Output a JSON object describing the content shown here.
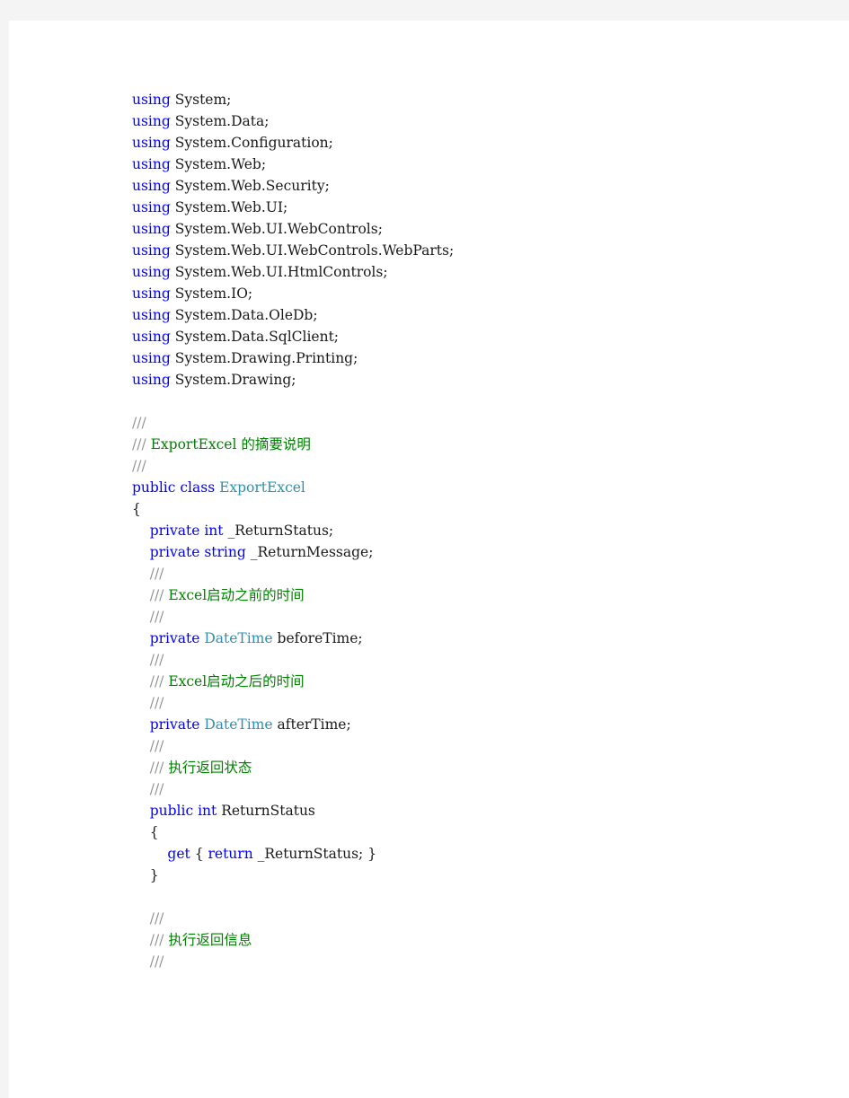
{
  "document": {
    "language": "csharp",
    "colors": {
      "page_background": "#ffffff",
      "outer_background": "#f4f4f4",
      "keyword": "#0000ff",
      "type": "#2b91af",
      "comment": "#008000",
      "comment_slash": "#909090",
      "plain": "#1a1a1a"
    },
    "lines": [
      {
        "indent": 0,
        "tokens": [
          {
            "t": "using ",
            "c": "kw"
          },
          {
            "t": "System;",
            "c": "pln"
          }
        ]
      },
      {
        "indent": 0,
        "tokens": [
          {
            "t": "using ",
            "c": "kw"
          },
          {
            "t": "System.Data;",
            "c": "pln"
          }
        ]
      },
      {
        "indent": 0,
        "tokens": [
          {
            "t": "using ",
            "c": "kw"
          },
          {
            "t": "System.Configuration;",
            "c": "pln"
          }
        ]
      },
      {
        "indent": 0,
        "tokens": [
          {
            "t": "using ",
            "c": "kw"
          },
          {
            "t": "System.Web;",
            "c": "pln"
          }
        ]
      },
      {
        "indent": 0,
        "tokens": [
          {
            "t": "using ",
            "c": "kw"
          },
          {
            "t": "System.Web.Security;",
            "c": "pln"
          }
        ]
      },
      {
        "indent": 0,
        "tokens": [
          {
            "t": "using ",
            "c": "kw"
          },
          {
            "t": "System.Web.UI;",
            "c": "pln"
          }
        ]
      },
      {
        "indent": 0,
        "tokens": [
          {
            "t": "using ",
            "c": "kw"
          },
          {
            "t": "System.Web.UI.WebControls;",
            "c": "pln"
          }
        ]
      },
      {
        "indent": 0,
        "tokens": [
          {
            "t": "using ",
            "c": "kw"
          },
          {
            "t": "System.Web.UI.WebControls.WebParts;",
            "c": "pln"
          }
        ]
      },
      {
        "indent": 0,
        "tokens": [
          {
            "t": "using ",
            "c": "kw"
          },
          {
            "t": "System.Web.UI.HtmlControls;",
            "c": "pln"
          }
        ]
      },
      {
        "indent": 0,
        "tokens": [
          {
            "t": "using ",
            "c": "kw"
          },
          {
            "t": "System.IO;",
            "c": "pln"
          }
        ]
      },
      {
        "indent": 0,
        "tokens": [
          {
            "t": "using ",
            "c": "kw"
          },
          {
            "t": "System.Data.OleDb;",
            "c": "pln"
          }
        ]
      },
      {
        "indent": 0,
        "tokens": [
          {
            "t": "using ",
            "c": "kw"
          },
          {
            "t": "System.Data.SqlClient;",
            "c": "pln"
          }
        ]
      },
      {
        "indent": 0,
        "tokens": [
          {
            "t": "using ",
            "c": "kw"
          },
          {
            "t": "System.Drawing.Printing;",
            "c": "pln"
          }
        ]
      },
      {
        "indent": 0,
        "tokens": [
          {
            "t": "using ",
            "c": "kw"
          },
          {
            "t": "System.Drawing;",
            "c": "pln"
          }
        ]
      },
      {
        "indent": 0,
        "tokens": []
      },
      {
        "indent": 0,
        "tokens": [
          {
            "t": "///",
            "c": "cmt-slash"
          }
        ]
      },
      {
        "indent": 0,
        "tokens": [
          {
            "t": "/// ",
            "c": "cmt-slash"
          },
          {
            "t": "ExportExcel 的摘要说明",
            "c": "cmt"
          }
        ]
      },
      {
        "indent": 0,
        "tokens": [
          {
            "t": "///",
            "c": "cmt-slash"
          }
        ]
      },
      {
        "indent": 0,
        "tokens": [
          {
            "t": "public ",
            "c": "kw"
          },
          {
            "t": "class ",
            "c": "kw"
          },
          {
            "t": "ExportExcel",
            "c": "type"
          }
        ]
      },
      {
        "indent": 0,
        "tokens": [
          {
            "t": "{",
            "c": "pln"
          }
        ]
      },
      {
        "indent": 1,
        "tokens": [
          {
            "t": "private ",
            "c": "kw"
          },
          {
            "t": "int ",
            "c": "kw"
          },
          {
            "t": "_ReturnStatus;",
            "c": "pln"
          }
        ]
      },
      {
        "indent": 1,
        "tokens": [
          {
            "t": "private ",
            "c": "kw"
          },
          {
            "t": "string ",
            "c": "kw"
          },
          {
            "t": "_ReturnMessage;",
            "c": "pln"
          }
        ]
      },
      {
        "indent": 1,
        "tokens": [
          {
            "t": "///",
            "c": "cmt-slash"
          }
        ]
      },
      {
        "indent": 1,
        "tokens": [
          {
            "t": "/// ",
            "c": "cmt-slash"
          },
          {
            "t": "Excel启动之前的时间",
            "c": "cmt"
          }
        ]
      },
      {
        "indent": 1,
        "tokens": [
          {
            "t": "///",
            "c": "cmt-slash"
          }
        ]
      },
      {
        "indent": 1,
        "tokens": [
          {
            "t": "private ",
            "c": "kw"
          },
          {
            "t": "DateTime ",
            "c": "type"
          },
          {
            "t": "beforeTime;",
            "c": "pln"
          }
        ]
      },
      {
        "indent": 1,
        "tokens": [
          {
            "t": "///",
            "c": "cmt-slash"
          }
        ]
      },
      {
        "indent": 1,
        "tokens": [
          {
            "t": "/// ",
            "c": "cmt-slash"
          },
          {
            "t": "Excel启动之后的时间",
            "c": "cmt"
          }
        ]
      },
      {
        "indent": 1,
        "tokens": [
          {
            "t": "///",
            "c": "cmt-slash"
          }
        ]
      },
      {
        "indent": 1,
        "tokens": [
          {
            "t": "private ",
            "c": "kw"
          },
          {
            "t": "DateTime ",
            "c": "type"
          },
          {
            "t": "afterTime;",
            "c": "pln"
          }
        ]
      },
      {
        "indent": 1,
        "tokens": [
          {
            "t": "///",
            "c": "cmt-slash"
          }
        ]
      },
      {
        "indent": 1,
        "tokens": [
          {
            "t": "/// ",
            "c": "cmt-slash"
          },
          {
            "t": "执行返回状态",
            "c": "cmt"
          }
        ]
      },
      {
        "indent": 1,
        "tokens": [
          {
            "t": "///",
            "c": "cmt-slash"
          }
        ]
      },
      {
        "indent": 1,
        "tokens": [
          {
            "t": "public ",
            "c": "kw"
          },
          {
            "t": "int ",
            "c": "kw"
          },
          {
            "t": "ReturnStatus",
            "c": "pln"
          }
        ]
      },
      {
        "indent": 1,
        "tokens": [
          {
            "t": "{",
            "c": "pln"
          }
        ]
      },
      {
        "indent": 2,
        "tokens": [
          {
            "t": "get ",
            "c": "kw"
          },
          {
            "t": "{ ",
            "c": "pln"
          },
          {
            "t": "return ",
            "c": "kw"
          },
          {
            "t": "_ReturnStatus; }",
            "c": "pln"
          }
        ]
      },
      {
        "indent": 1,
        "tokens": [
          {
            "t": "}",
            "c": "pln"
          }
        ]
      },
      {
        "indent": 0,
        "tokens": []
      },
      {
        "indent": 1,
        "tokens": [
          {
            "t": "///",
            "c": "cmt-slash"
          }
        ]
      },
      {
        "indent": 1,
        "tokens": [
          {
            "t": "/// ",
            "c": "cmt-slash"
          },
          {
            "t": "执行返回信息",
            "c": "cmt"
          }
        ]
      },
      {
        "indent": 1,
        "tokens": [
          {
            "t": "///",
            "c": "cmt-slash"
          }
        ]
      }
    ]
  }
}
